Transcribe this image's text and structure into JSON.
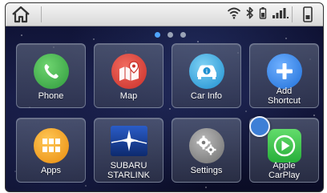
{
  "status_bar": {
    "icons": [
      "home-icon",
      "wifi-icon",
      "bluetooth-icon",
      "battery-icon",
      "signal-icon",
      "phone-icon"
    ]
  },
  "page_indicator": {
    "pages": 3,
    "current": 1
  },
  "apps": [
    {
      "id": "phone",
      "label": "Phone",
      "icon": "phone-icon",
      "color": "#3fae49"
    },
    {
      "id": "map",
      "label": "Map",
      "icon": "map-icon",
      "color": "#d9413a"
    },
    {
      "id": "car-info",
      "label": "Car Info",
      "icon": "car-icon",
      "color": "#26a2e0"
    },
    {
      "id": "add-shortcut",
      "label": "Add Shortcut",
      "label_line1": "Add",
      "label_line2": "Shortcut",
      "icon": "plus-icon",
      "color": "#2f7fe0"
    },
    {
      "id": "apps",
      "label": "Apps",
      "icon": "grid-icon",
      "color": "#f2a114"
    },
    {
      "id": "subaru-starlink",
      "label": "SUBARU STARLINK",
      "label_line1": "SUBARU",
      "label_line2": "STARLINK",
      "icon": "starlink-icon",
      "color": "#1b3c8c"
    },
    {
      "id": "settings",
      "label": "Settings",
      "icon": "gears-icon",
      "color": "#8a8a8a"
    },
    {
      "id": "apple-carplay",
      "label": "Apple CarPlay",
      "label_line1": "Apple",
      "label_line2": "CarPlay",
      "icon": "carplay-icon",
      "color": "#3cc24a"
    }
  ]
}
